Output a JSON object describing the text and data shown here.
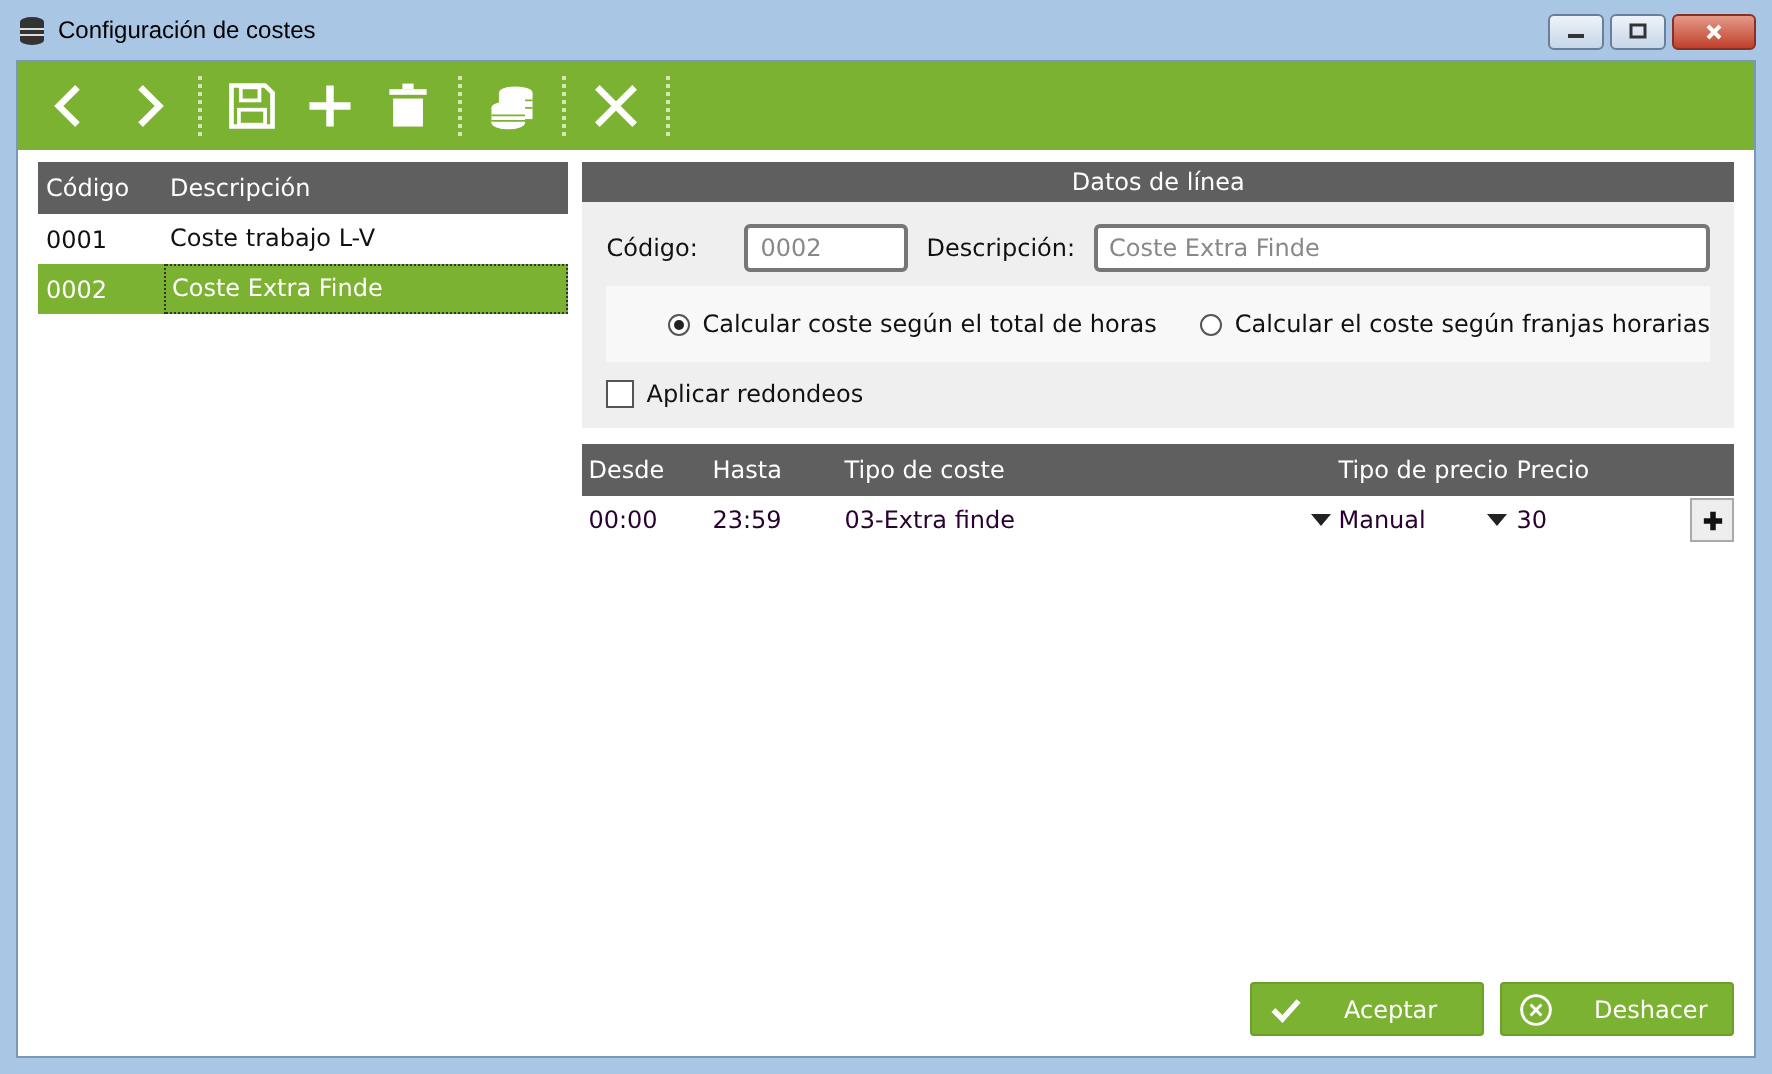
{
  "window": {
    "title": "Configuración de costes"
  },
  "toolbar": [
    {
      "kind": "prev"
    },
    {
      "kind": "next"
    },
    {
      "kind": "sep"
    },
    {
      "kind": "save"
    },
    {
      "kind": "add"
    },
    {
      "kind": "delete"
    },
    {
      "kind": "sep"
    },
    {
      "kind": "coins"
    },
    {
      "kind": "sep"
    },
    {
      "kind": "close"
    },
    {
      "kind": "sep"
    }
  ],
  "list": {
    "columns": [
      "Código",
      "Descripción"
    ],
    "rows": [
      {
        "code": "0001",
        "description": "Coste trabajo L-V",
        "selected": false
      },
      {
        "code": "0002",
        "description": "Coste Extra Finde",
        "selected": true
      }
    ]
  },
  "line_data": {
    "title": "Datos de línea",
    "code": {
      "label": "Código:",
      "value": "0002"
    },
    "description": {
      "label": "Descripción:",
      "value": "Coste Extra Finde"
    },
    "modes": [
      {
        "label": "Calcular coste según el total de horas",
        "selected": true
      },
      {
        "label": "Calcular el coste según franjas horarias",
        "selected": false
      }
    ],
    "rounding": {
      "label": "Aplicar redondeos",
      "checked": false
    }
  },
  "table": {
    "columns": [
      "Desde",
      "Hasta",
      "Tipo de coste",
      "Tipo de precio",
      "Precio"
    ],
    "rows": [
      {
        "from": "00:00",
        "to": "23:59",
        "cost_type": "03-Extra finde",
        "price_type": "Manual",
        "price": "30"
      }
    ]
  },
  "buttons": [
    {
      "kind": "accept",
      "label": "Aceptar"
    },
    {
      "kind": "undo",
      "label": "Deshacer"
    }
  ]
}
